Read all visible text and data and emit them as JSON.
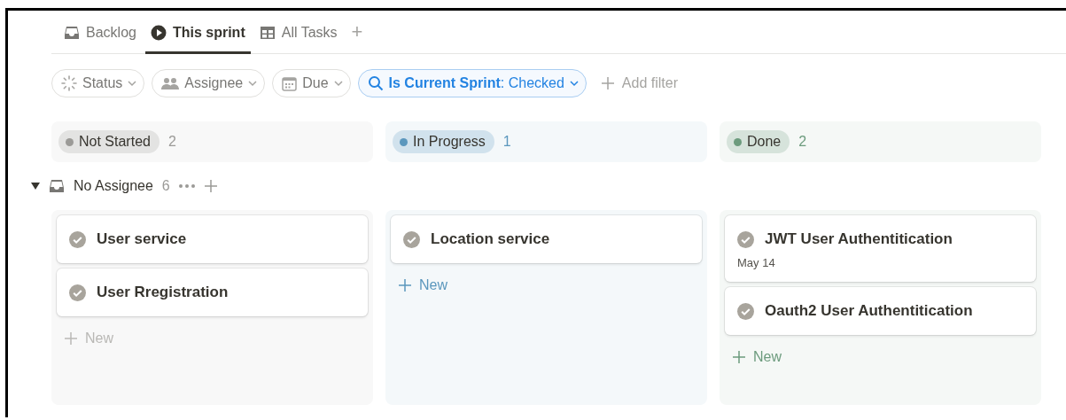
{
  "tabs": [
    {
      "label": "Backlog",
      "selected": false
    },
    {
      "label": "This sprint",
      "selected": true
    },
    {
      "label": "All Tasks",
      "selected": false
    }
  ],
  "add_view": "+",
  "filters": [
    {
      "label": "Status",
      "active": false
    },
    {
      "label": "Assignee",
      "active": false
    },
    {
      "label": "Due",
      "active": false
    },
    {
      "label": "**Is Current Sprint**: Checked",
      "active": true
    }
  ],
  "add_filter": "Add filter",
  "columns": [
    {
      "status": "Not Started",
      "count": "2",
      "color": "#9b9a97",
      "new_label": "New",
      "cards": [
        {
          "title": "User service"
        },
        {
          "title": "User Rregistration"
        }
      ]
    },
    {
      "status": "In Progress",
      "count": "1",
      "color": "#5b97bd",
      "new_label": "New",
      "cards": [
        {
          "title": "Location service"
        }
      ]
    },
    {
      "status": "Done",
      "count": "2",
      "color": "#6c9b7d",
      "new_label": "New",
      "cards": [
        {
          "title": "JWT User Authentitication",
          "date": "May 14"
        },
        {
          "title": "Oauth2 User Authentitication"
        }
      ]
    }
  ],
  "group": {
    "name": "No Assignee",
    "count": "6",
    "expanded": true
  }
}
